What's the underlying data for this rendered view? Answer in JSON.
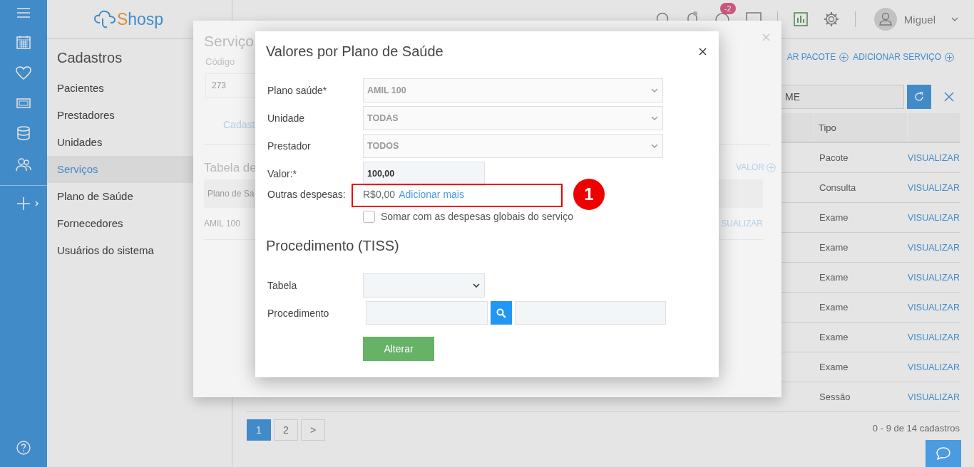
{
  "logo": {
    "parts": [
      "S",
      "hosp"
    ]
  },
  "sidebar": {
    "title": "Cadastros",
    "items": [
      {
        "label": "Pacientes",
        "selected": false
      },
      {
        "label": "Prestadores",
        "selected": false
      },
      {
        "label": "Unidades",
        "selected": false
      },
      {
        "label": "Serviços",
        "selected": true
      },
      {
        "label": "Plano de Saúde",
        "selected": false
      },
      {
        "label": "Fornecedores",
        "selected": false
      },
      {
        "label": "Usuários do sistema",
        "selected": false
      }
    ]
  },
  "header": {
    "badge": "-2",
    "user": "Miguel"
  },
  "toolbar": {
    "actions": [
      "AR PACOTE",
      "ADICIONAR SERVIÇO"
    ]
  },
  "search": {
    "value": "ME"
  },
  "table": {
    "columns": [
      "Tipo"
    ],
    "rows": [
      {
        "type": "Pacote",
        "action": "VISUALIZAR"
      },
      {
        "type": "Consulta",
        "action": "VISUALIZAR"
      },
      {
        "type": "Exame",
        "action": "VISUALIZAR"
      },
      {
        "type": "Exame",
        "action": "VISUALIZAR"
      },
      {
        "type": "Exame",
        "action": "VISUALIZAR"
      },
      {
        "type": "Exame",
        "action": "VISUALIZAR"
      },
      {
        "type": "Exame",
        "action": "VISUALIZAR"
      },
      {
        "type": "Exame",
        "action": "VISUALIZAR"
      },
      {
        "type": "Sessão",
        "action": "VISUALIZAR"
      }
    ]
  },
  "pagination": {
    "pages": [
      {
        "label": "1",
        "selected": true
      },
      {
        "label": "2",
        "selected": false
      },
      {
        "label": ">",
        "selected": false
      }
    ],
    "summary": "0 - 9 de 14 cadastros"
  },
  "service_modal": {
    "title": "Serviço",
    "code_label": "Código",
    "code_value": "273",
    "tab": "Cadast",
    "table_title": "Tabela de",
    "add_link": "VALOR",
    "column": "Plano de Sa",
    "row": {
      "plan": "AMIL 100",
      "action": "SUALIZAR"
    }
  },
  "dialog": {
    "title": "Valores por Plano de Saúde",
    "fields": [
      {
        "kind": "select",
        "label": "Plano saúde*",
        "value": "AMIL 100",
        "disabled": true
      },
      {
        "kind": "select",
        "label": "Unidade",
        "value": "TODAS",
        "disabled": true
      },
      {
        "kind": "select",
        "label": "Prestador",
        "value": "TODOS",
        "disabled": true
      },
      {
        "kind": "input",
        "label": "Valor:*",
        "value": "100,00",
        "disabled": false
      }
    ],
    "other_expenses": {
      "label": "Outras despesas:",
      "amount": "R$0,00",
      "link": "Adicionar mais"
    },
    "sum_checkbox": {
      "label": "Somar com as despesas globais do serviço",
      "checked": false
    },
    "section_title": "Procedimento (TISS)",
    "table_field": {
      "label": "Tabela"
    },
    "procedure_field": {
      "label": "Procedimento"
    },
    "submit": "Alterar"
  },
  "annotation": {
    "number": "1"
  }
}
